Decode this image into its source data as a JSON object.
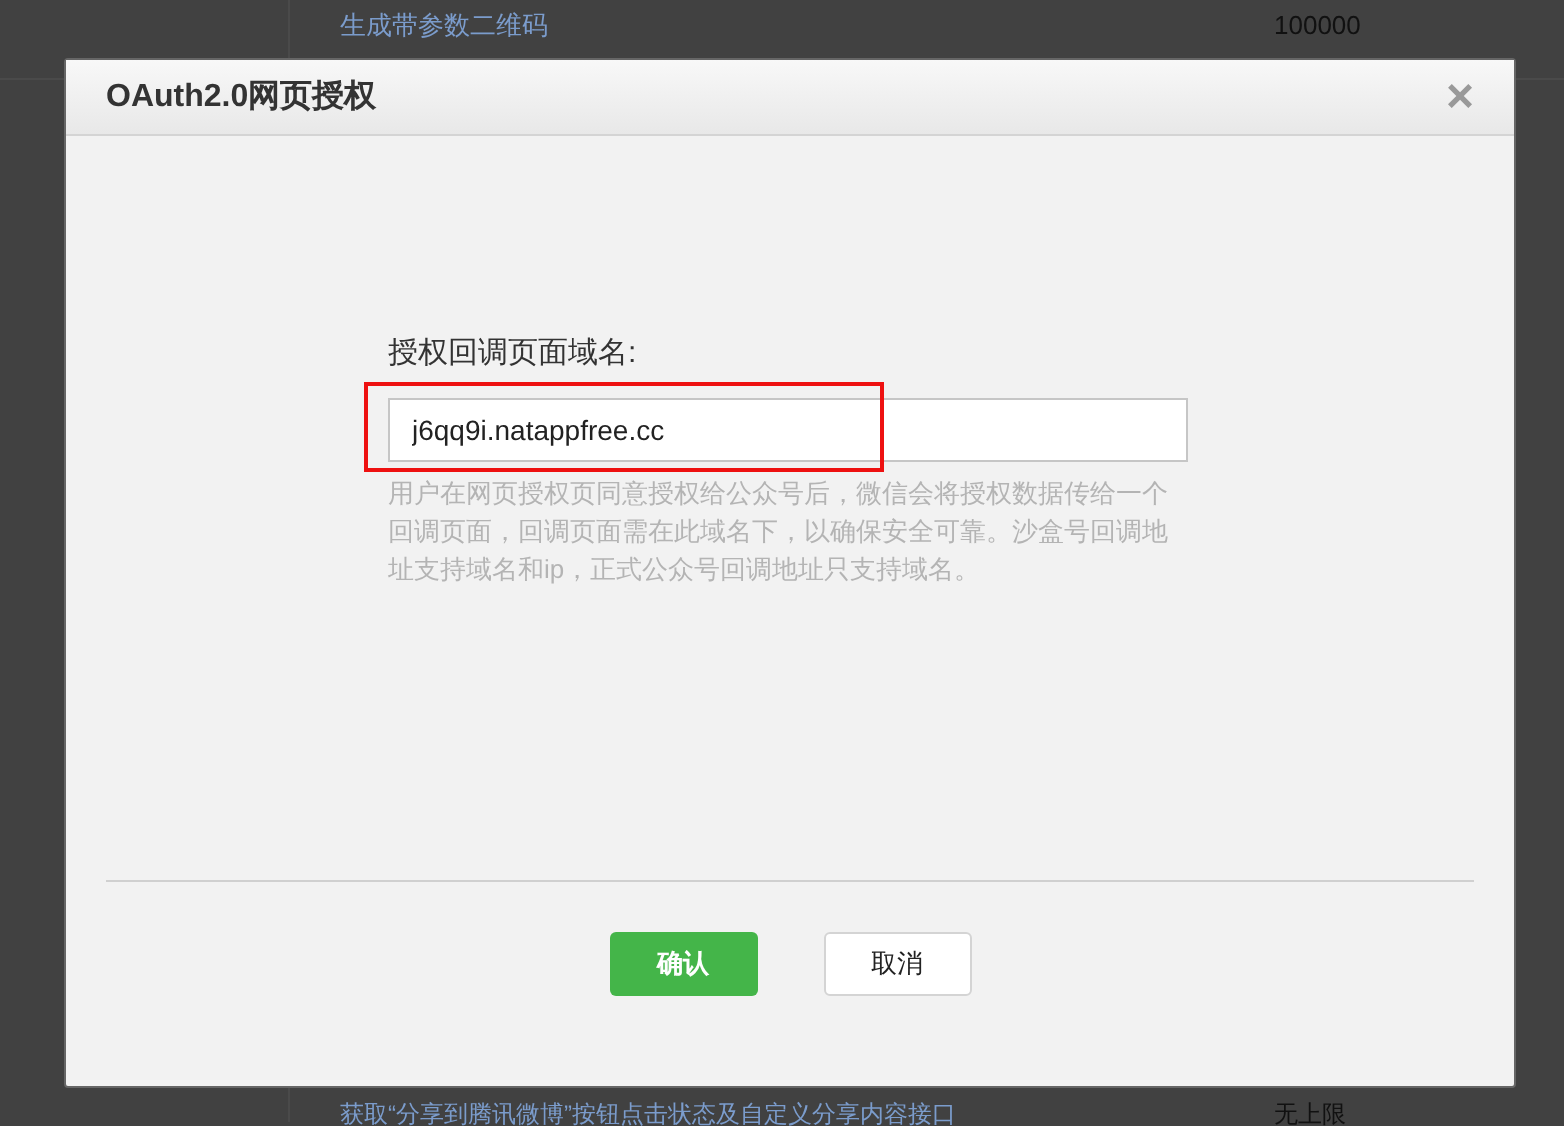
{
  "background_table": {
    "rows": [
      {
        "column_2": "生成带参数二维码",
        "column_3": "100000"
      },
      {
        "column_2": "获取“分享到腾讯微博”按钮点击状态及自定义分享内容接口",
        "column_3": "无上限"
      }
    ]
  },
  "dialog": {
    "title": "OAuth2.0网页授权",
    "close": "×",
    "field": {
      "label": "授权回调页面域名:",
      "value": "j6qq9i.natappfree.cc",
      "highlighted": true
    },
    "help": "用户在网页授权页同意授权给公众号后，微信会将授权数据传给一个回调页面，回调页面需在此域名下，以确保安全可靠。沙盒号回调地址支持域名和ip，正式公众号回调地址只支持域名。",
    "buttons": [
      {
        "label": "确认",
        "kind": "primary"
      },
      {
        "label": "取消",
        "kind": "secondary"
      }
    ]
  }
}
